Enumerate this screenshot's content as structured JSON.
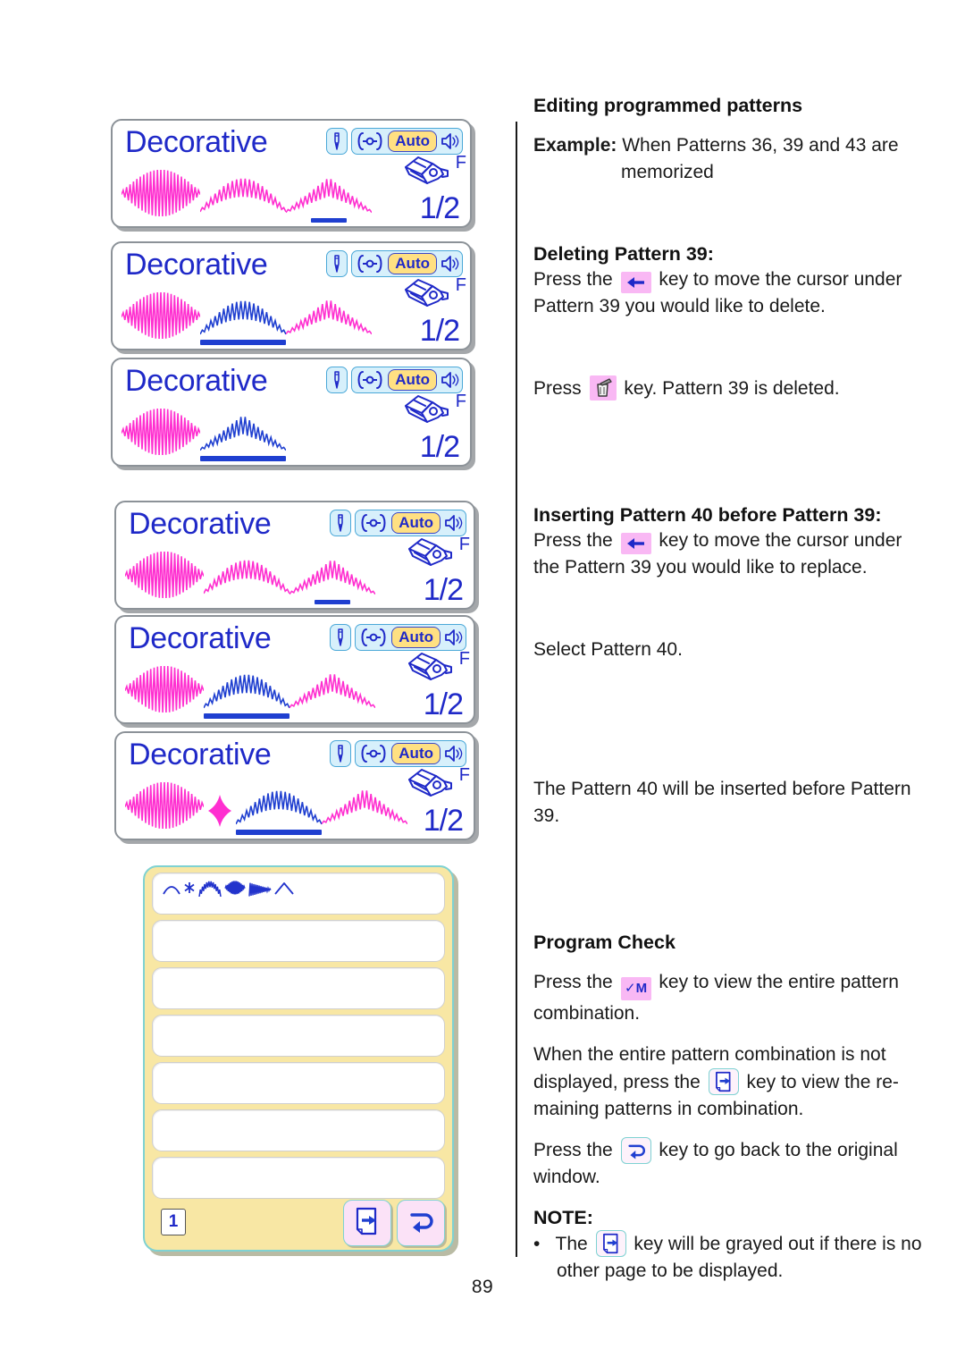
{
  "page": {
    "number": "89"
  },
  "lcd_panels": [
    {
      "id": "panel-1",
      "title": "Decorative",
      "auto_label": "Auto",
      "foot_letter": "F",
      "page_indicator": "1/2",
      "patterns": [
        {
          "shape": "dense-satin-oval",
          "color": "#ff2fd0",
          "cursor": "none"
        },
        {
          "shape": "arch-fan",
          "color": "#ff2fd0",
          "cursor": "none"
        },
        {
          "shape": "peak-fan",
          "color": "#ff2fd0",
          "cursor": "thin"
        }
      ]
    },
    {
      "id": "panel-2",
      "title": "Decorative",
      "auto_label": "Auto",
      "foot_letter": "F",
      "page_indicator": "1/2",
      "patterns": [
        {
          "shape": "dense-satin-oval",
          "color": "#ff2fd0",
          "cursor": "none"
        },
        {
          "shape": "arch-fan",
          "color": "#1f3fd0",
          "cursor": "wide"
        },
        {
          "shape": "peak-fan",
          "color": "#ff2fd0",
          "cursor": "none"
        }
      ]
    },
    {
      "id": "panel-3",
      "title": "Decorative",
      "auto_label": "Auto",
      "foot_letter": "F",
      "page_indicator": "1/2",
      "patterns": [
        {
          "shape": "dense-satin-oval",
          "color": "#ff2fd0",
          "cursor": "none"
        },
        {
          "shape": "peak-fan",
          "color": "#1f3fd0",
          "cursor": "wide"
        }
      ]
    },
    {
      "id": "panel-4",
      "title": "Decorative",
      "auto_label": "Auto",
      "foot_letter": "F",
      "page_indicator": "1/2",
      "patterns": [
        {
          "shape": "dense-satin-oval",
          "color": "#ff2fd0",
          "cursor": "none"
        },
        {
          "shape": "arch-fan",
          "color": "#ff2fd0",
          "cursor": "none"
        },
        {
          "shape": "peak-fan",
          "color": "#ff2fd0",
          "cursor": "thin"
        }
      ]
    },
    {
      "id": "panel-5",
      "title": "Decorative",
      "auto_label": "Auto",
      "foot_letter": "F",
      "page_indicator": "1/2",
      "patterns": [
        {
          "shape": "dense-satin-oval",
          "color": "#ff2fd0",
          "cursor": "none"
        },
        {
          "shape": "arch-fan",
          "color": "#1f3fd0",
          "cursor": "wide"
        },
        {
          "shape": "peak-fan",
          "color": "#ff2fd0",
          "cursor": "none"
        }
      ]
    },
    {
      "id": "panel-6",
      "title": "Decorative",
      "auto_label": "Auto",
      "foot_letter": "F",
      "page_indicator": "1/2",
      "patterns": [
        {
          "shape": "dense-satin-oval",
          "color": "#ff2fd0",
          "cursor": "none"
        },
        {
          "shape": "diamond",
          "color": "#ff2fd0",
          "cursor": "none"
        },
        {
          "shape": "arch-fan",
          "color": "#1f3fd0",
          "cursor": "wide"
        },
        {
          "shape": "peak-fan",
          "color": "#ff2fd0",
          "cursor": "none"
        }
      ]
    }
  ],
  "program_check_dialog": {
    "row_count": 7,
    "first_row_glyphs": [
      "arc",
      "asterisk",
      "arch-small",
      "satin-oval",
      "taper",
      "peak"
    ],
    "page_number": "1",
    "buttons": [
      {
        "name": "next-page",
        "icon": "page-forward-icon"
      },
      {
        "name": "back",
        "icon": "return-arrow-icon"
      }
    ]
  },
  "right_column": {
    "heading_editing": "Editing programmed patterns",
    "example_label": "Example:",
    "example_text": "When Patterns 36, 39 and 43 are",
    "example_text_2": "memorized",
    "heading_deleting": "Deleting Pattern 39:",
    "delete_line1_a": "Press the",
    "delete_line1_b": "key to move the cursor under",
    "delete_line2": "Pattern 39 you would like to delete.",
    "delete_line3_a": "Press",
    "delete_line3_b": "key. Pattern 39 is deleted.",
    "heading_inserting": "Inserting Pattern 40 before Pattern 39:",
    "insert_line1_a": "Press the",
    "insert_line1_b": "key to move the cursor under",
    "insert_line2": "the Pattern 39 you would like to replace.",
    "insert_line3": "Select Pattern 40.",
    "insert_line4": "The Pattern 40 will be inserted before Pattern",
    "insert_line5": "39.",
    "heading_program_check": "Program Check",
    "pc_line1_a": "Press the",
    "pc_line1_b": "key to view the entire pattern",
    "pc_line1_c": "combination.",
    "pc_line2_a": "When the entire pattern combination is not",
    "pc_line2_b": "displayed, press the",
    "pc_line2_c": "key to view the re-",
    "pc_line2_d": "maining patterns in combination.",
    "pc_line3_a": "Press the",
    "pc_line3_b": "key to go back to the original",
    "pc_line3_c": "window.",
    "note_label": "NOTE:",
    "note_a": "The",
    "note_b": "key will be grayed out if there is no",
    "note_c": "other page to be displayed."
  },
  "colors": {
    "lcd_blue": "#1f29c8",
    "stitch_magenta": "#ff2fd0",
    "stitch_blue": "#1f3fd0",
    "auto_yellow": "#ffe082",
    "chip_cyan": "#d7f0fb",
    "dialog_yellow": "#f8e7a4",
    "key_pink": "#f9b8f4",
    "key_teal_border": "#7fd2d2"
  }
}
